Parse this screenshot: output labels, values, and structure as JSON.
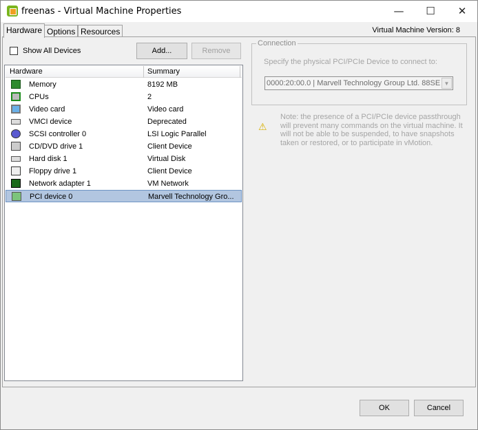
{
  "window": {
    "title": "freenas - Virtual Machine Properties",
    "minimize": "—",
    "maximize": "☐",
    "close": "✕"
  },
  "tabs": [
    {
      "label": "Hardware"
    },
    {
      "label": "Options"
    },
    {
      "label": "Resources"
    }
  ],
  "version": "Virtual Machine Version: 8",
  "show_all_devices": {
    "label": "Show All Devices",
    "checked": false
  },
  "buttons": {
    "add": "Add...",
    "remove": "Remove",
    "ok": "OK",
    "cancel": "Cancel"
  },
  "table": {
    "headers": [
      "Hardware",
      "Summary"
    ],
    "rows": [
      {
        "name": "Memory",
        "summary": "8192 MB",
        "icon": "memory-icon"
      },
      {
        "name": "CPUs",
        "summary": "2",
        "icon": "cpu-icon"
      },
      {
        "name": "Video card",
        "summary": "Video card",
        "icon": "monitor-icon"
      },
      {
        "name": "VMCI device",
        "summary": "Deprecated",
        "icon": "device-icon"
      },
      {
        "name": "SCSI controller 0",
        "summary": "LSI Logic Parallel",
        "icon": "scsi-icon"
      },
      {
        "name": "CD/DVD drive 1",
        "summary": "Client Device",
        "icon": "cd-drive-icon"
      },
      {
        "name": "Hard disk 1",
        "summary": "Virtual Disk",
        "icon": "hard-disk-icon"
      },
      {
        "name": "Floppy drive 1",
        "summary": "Client Device",
        "icon": "floppy-icon"
      },
      {
        "name": "Network adapter 1",
        "summary": "VM Network",
        "icon": "network-adapter-icon"
      },
      {
        "name": "PCI device 0",
        "summary": "Marvell Technology Gro...",
        "icon": "pci-card-icon",
        "selected": true
      }
    ]
  },
  "connection": {
    "legend": "Connection",
    "label": "Specify the physical PCI/PCIe Device to connect to:",
    "selected": "0000:20:00.0 | Marvell Technology Group Ltd. 88SE"
  },
  "note": "Note: the presence of a PCI/PCIe device passthrough will prevent many commands on the virtual machine. It will not be able to be suspended, to have snapshots taken or restored, or to participate in vMotion."
}
